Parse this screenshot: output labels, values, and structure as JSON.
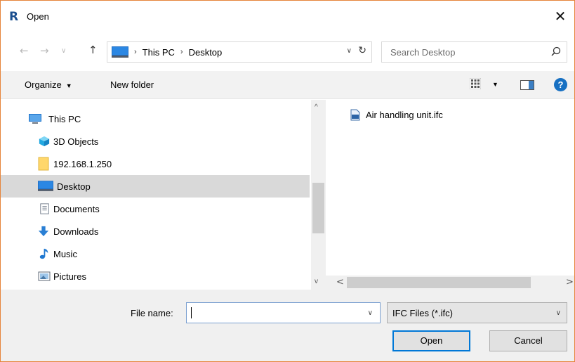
{
  "window": {
    "title": "Open",
    "app_logo_letter": "R",
    "close_glyph": "✕"
  },
  "nav": {
    "back_glyph": "←",
    "forward_glyph": "→",
    "history_glyph": "∨",
    "up_glyph": "↑",
    "breadcrumb": [
      "This PC",
      "Desktop"
    ],
    "breadcrumb_sep": "›",
    "dropdown_glyph": "∨",
    "refresh_glyph": "↻"
  },
  "search": {
    "placeholder": "Search Desktop"
  },
  "toolbar": {
    "organize_label": "Organize",
    "organize_caret": "▼",
    "new_folder_label": "New folder",
    "view_caret": "▼",
    "help_label": "?"
  },
  "sidebar": {
    "items": [
      {
        "label": "This PC",
        "icon": "computer-icon",
        "selected": false
      },
      {
        "label": "3D Objects",
        "icon": "cube-icon",
        "selected": false
      },
      {
        "label": "192.168.1.250",
        "icon": "folder-icon",
        "selected": false
      },
      {
        "label": "Desktop",
        "icon": "desktop-icon",
        "selected": true
      },
      {
        "label": "Documents",
        "icon": "document-icon",
        "selected": false
      },
      {
        "label": "Downloads",
        "icon": "download-icon",
        "selected": false
      },
      {
        "label": "Music",
        "icon": "music-icon",
        "selected": false
      },
      {
        "label": "Pictures",
        "icon": "pictures-icon",
        "selected": false
      }
    ]
  },
  "scroll": {
    "up_glyph": "^",
    "down_glyph": "v",
    "left_glyph": "<",
    "right_glyph": ">"
  },
  "files": [
    {
      "name": "Air handling unit.ifc",
      "icon": "ifc-file-icon"
    }
  ],
  "bottom": {
    "file_name_label": "File name:",
    "file_name_value": "",
    "file_type_value": "IFC Files (*.ifc)",
    "open_label": "Open",
    "cancel_label": "Cancel",
    "dropdown_glyph": "∨"
  },
  "colors": {
    "window_border": "#e6843a",
    "selection": "#d9d9d9",
    "accent": "#0078d7"
  }
}
